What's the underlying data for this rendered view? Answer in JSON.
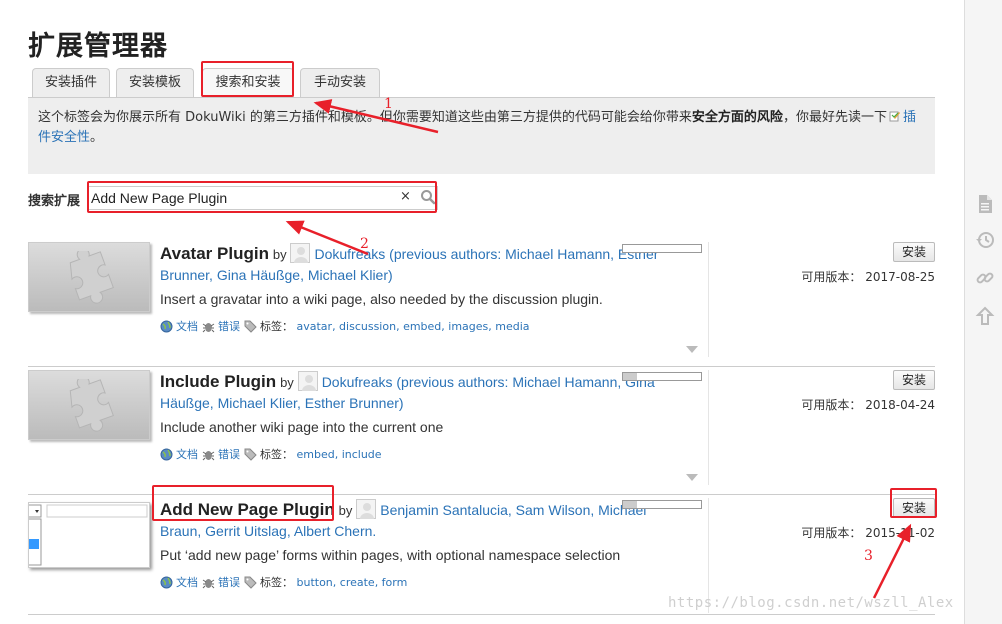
{
  "page": {
    "title": "扩展管理器"
  },
  "tabs": [
    {
      "label": "安装插件"
    },
    {
      "label": "安装模板"
    },
    {
      "label": "搜索和安装"
    },
    {
      "label": "手动安装"
    }
  ],
  "info": {
    "text_before": "这个标签会为你展示所有 DokuWiki 的第三方插件和模板。但你需要知道这些由第三方提供的代码可能会给你带来",
    "bold": "安全方面的风险",
    "text_after": "，你最好先读一下",
    "link": "插件安全性",
    "end": "。"
  },
  "search": {
    "label": "搜索扩展",
    "value": "Add New Page Plugin",
    "clear_symbol": "×"
  },
  "labels": {
    "by": "by",
    "docs": "文档",
    "bugs": "错误",
    "tags": "标签：",
    "install": "安装",
    "available_version": "可用版本："
  },
  "plugins": [
    {
      "name": "Avatar Plugin",
      "authors": "Dokufreaks (previous authors: Michael Hamann, Esther Brunner, Gina Häußge, Michael Klier)",
      "description": "Insert a gravatar into a wiki page, also needed by the discussion plugin.",
      "tags": "avatar, discussion, embed, images, media",
      "version": "2017-08-25",
      "popularity": 0
    },
    {
      "name": "Include Plugin",
      "authors": "Dokufreaks (previous authors: Michael Hamann, Gina Häußge, Michael Klier, Esther Brunner)",
      "description": "Include another wiki page into the current one",
      "tags": "embed, include",
      "version": "2018-04-24",
      "popularity": 0.18
    },
    {
      "name": "Add New Page Plugin",
      "authors": "Benjamin Santalucia, Sam Wilson, Michael Braun, Gerrit Uitslag, Albert Chern.",
      "description": "Put ‘add new page’ forms within pages, with optional namespace selection",
      "tags": "button, create, form",
      "version": "2015-11-02",
      "popularity": 0.18
    }
  ],
  "annotations": [
    "1",
    "2",
    "3"
  ],
  "watermark": "https://blog.csdn.net/wszll_Alex",
  "colors": {
    "link": "#2b73b7",
    "annotation": "#e8202a",
    "info_bg": "#eeeeee"
  },
  "icons": {
    "docs": "globe-icon",
    "bugs": "bug-icon",
    "tags": "tag-icon",
    "search": "magnifier-icon",
    "tools": [
      "page-icon",
      "history-icon",
      "link-icon",
      "arrow-up-icon"
    ]
  }
}
